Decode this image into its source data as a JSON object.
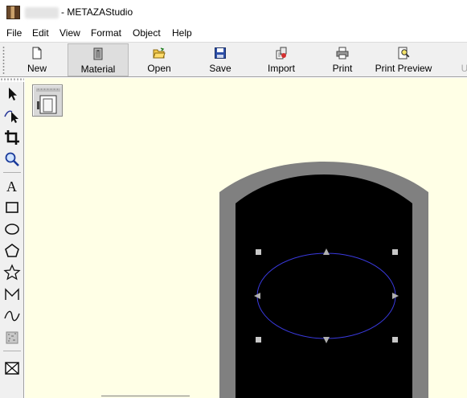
{
  "window": {
    "title": "- METAZAStudio"
  },
  "menu": [
    "File",
    "Edit",
    "View",
    "Format",
    "Object",
    "Help"
  ],
  "toolbar": {
    "new": "New",
    "material": "Material",
    "open": "Open",
    "save": "Save",
    "import": "Import",
    "print": "Print",
    "print_preview": "Print Preview",
    "cut_partial": "U"
  },
  "tools": [
    "select-arrow",
    "node-edit",
    "crop",
    "zoom",
    "text",
    "rectangle",
    "ellipse",
    "polygon",
    "star",
    "polyline",
    "curve",
    "texture",
    "image-frame"
  ],
  "colors": {
    "canvas_bg": "#ffffe6",
    "material_border": "#808080",
    "material_face": "#000000",
    "ellipse_stroke": "#3a3adf",
    "handle": "#c8c8c8"
  }
}
